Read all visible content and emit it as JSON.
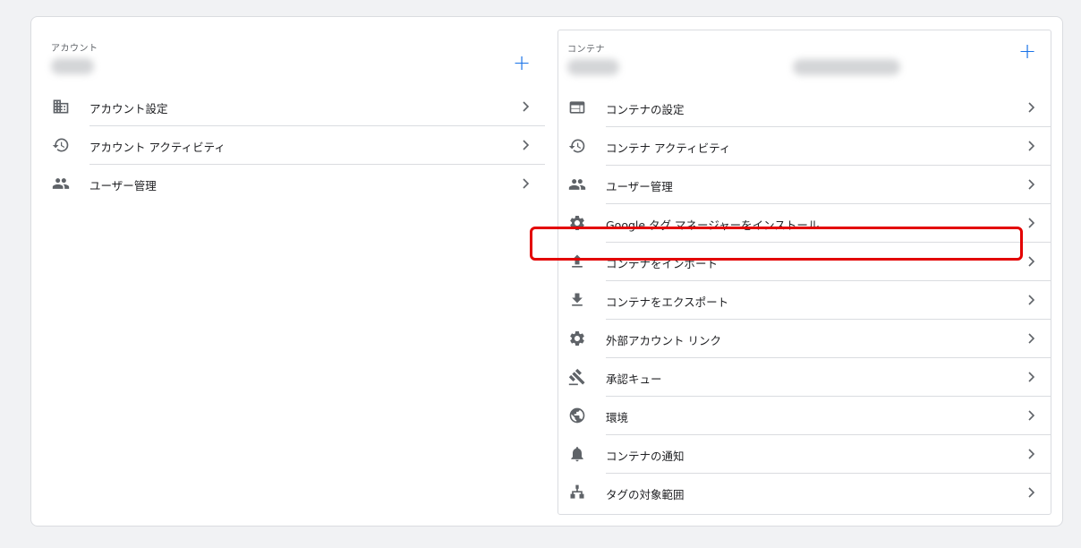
{
  "account": {
    "section_label": "アカウント",
    "items": [
      {
        "label": "アカウント設定",
        "icon": "building-icon"
      },
      {
        "label": "アカウント アクティビティ",
        "icon": "history-icon"
      },
      {
        "label": "ユーザー管理",
        "icon": "people-icon"
      }
    ]
  },
  "container": {
    "section_label": "コンテナ",
    "items": [
      {
        "label": "コンテナの設定",
        "icon": "web-window-icon"
      },
      {
        "label": "コンテナ アクティビティ",
        "icon": "history-icon"
      },
      {
        "label": "ユーザー管理",
        "icon": "people-icon"
      },
      {
        "label": "Google タグ マネージャーをインストール",
        "icon": "gear-icon"
      },
      {
        "label": "コンテナをインポート",
        "icon": "upload-icon"
      },
      {
        "label": "コンテナをエクスポート",
        "icon": "download-icon"
      },
      {
        "label": "外部アカウント リンク",
        "icon": "gear-icon"
      },
      {
        "label": "承認キュー",
        "icon": "gavel-icon"
      },
      {
        "label": "環境",
        "icon": "globe-icon"
      },
      {
        "label": "コンテナの通知",
        "icon": "bell-icon"
      },
      {
        "label": "タグの対象範囲",
        "icon": "sitemap-icon"
      }
    ]
  },
  "colors": {
    "accent": "#1a73e8",
    "highlight": "#e30000",
    "icon": "#5f6368"
  }
}
